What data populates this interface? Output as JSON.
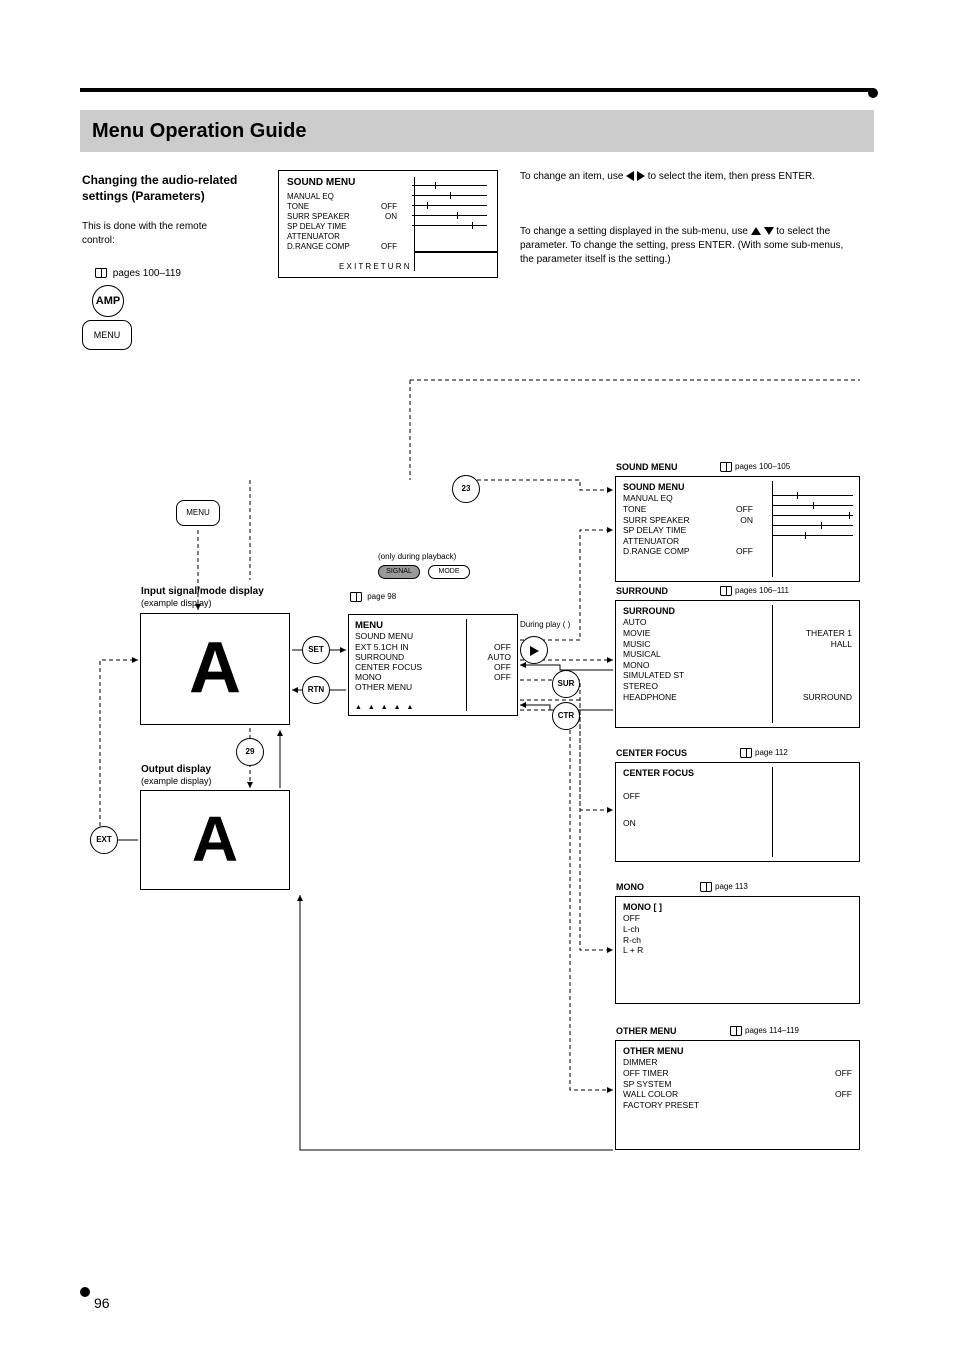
{
  "header": {
    "section_title": "Menu Operation Guide"
  },
  "intro": {
    "heading": "Changing the audio-related settings (Parameters)",
    "note": "This is done with the remote control:",
    "book_ref": "pages 100–119",
    "btn_amp": "AMP",
    "btn_menu": "MENU"
  },
  "top_panel": {
    "title": "SOUND MENU",
    "items": [
      "MANUAL EQ",
      "TONE",
      "SURR SPEAKER",
      "SP DELAY TIME",
      "ATTENUATOR",
      "D.RANGE COMP"
    ],
    "values": [
      "",
      "OFF",
      "ON",
      "",
      "",
      "OFF"
    ],
    "icons_caption": "E X I T  R E T U R N"
  },
  "instr1": {
    "text_a": "To change an item, use",
    "text_b": "to select the item, then press ENTER."
  },
  "instr2": {
    "text_a": "To change a setting displayed in the sub-menu, use",
    "text_b": "to select the parameter. To change the setting, press ENTER. (With some sub-menus, the parameter itself is the setting.)"
  },
  "flow": {
    "input_label": "Input signal/mode display",
    "input_note": "(example display)",
    "output_label": "Output display",
    "output_note": "(example display)",
    "menu_rrect": "MENU",
    "menu_circle": "23",
    "to_menu_btn": "SET",
    "from_menu_btn": "RTN",
    "io_toggle": "29",
    "exit_circle": "EXT",
    "cap_signal": "SIGNAL",
    "cap_mode": "MODE",
    "cap_note": "(only during playback)",
    "menu_book_ref": "page 98",
    "edge_play": "During play (  )",
    "round_btn_up": "SUR",
    "round_btn_down": "CTR"
  },
  "menu_panel": {
    "title": "MENU",
    "rows": [
      {
        "l": "SOUND MENU",
        "r": ""
      },
      {
        "l": "EXT 5.1CH IN",
        "r": "OFF"
      },
      {
        "l": "SURROUND",
        "r": "AUTO"
      },
      {
        "l": "CENTER FOCUS",
        "r": "OFF"
      },
      {
        "l": "MONO",
        "r": "OFF"
      },
      {
        "l": "OTHER MENU",
        "r": ""
      }
    ],
    "bars": [
      "▲",
      "▲",
      "▲",
      "▲",
      "▲"
    ]
  },
  "right_panels": {
    "p1": {
      "label": "SOUND MENU",
      "book": "pages 100–105",
      "title": "SOUND MENU",
      "rows": [
        {
          "l": "MANUAL EQ",
          "r": ""
        },
        {
          "l": "TONE",
          "r": "OFF"
        },
        {
          "l": "SURR SPEAKER",
          "r": "ON"
        },
        {
          "l": "SP DELAY TIME",
          "r": ""
        },
        {
          "l": "ATTENUATOR",
          "r": ""
        },
        {
          "l": "D.RANGE COMP",
          "r": "OFF"
        }
      ]
    },
    "p2": {
      "label": "SURROUND",
      "book": "pages 106–111",
      "title": "SURROUND",
      "rows": [
        {
          "l": "AUTO",
          "r": ""
        },
        {
          "l": "MOVIE",
          "r": "THEATER 1"
        },
        {
          "l": "MUSIC",
          "r": "HALL"
        },
        {
          "l": "MUSICAL",
          "r": ""
        },
        {
          "l": "MONO",
          "r": ""
        },
        {
          "l": "SIMULATED ST",
          "r": ""
        },
        {
          "l": "STEREO",
          "r": ""
        },
        {
          "l": "HEADPHONE",
          "r": "SURROUND"
        }
      ]
    },
    "p3": {
      "label": "CENTER FOCUS",
      "book": "page 112",
      "title": "CENTER FOCUS",
      "rows": [
        {
          "l": "OFF",
          "r": ""
        },
        {
          "l": "ON",
          "r": ""
        }
      ]
    },
    "p4": {
      "label": "MONO",
      "book": "page 113",
      "title": "MONO      [          ]",
      "rows": [
        {
          "l": "OFF",
          "r": ""
        },
        {
          "l": "L-ch",
          "r": ""
        },
        {
          "l": "R-ch",
          "r": ""
        },
        {
          "l": "L  +  R",
          "r": ""
        }
      ]
    },
    "p5": {
      "label": "OTHER MENU",
      "book": "pages 114–119",
      "title": "OTHER MENU",
      "rows": [
        {
          "l": "DIMMER",
          "r": ""
        },
        {
          "l": "OFF TIMER",
          "r": "OFF"
        },
        {
          "l": "SP SYSTEM",
          "r": ""
        },
        {
          "l": "WALL COLOR",
          "r": "OFF"
        },
        {
          "l": "FACTORY PRESET",
          "r": ""
        }
      ]
    }
  },
  "page_number": "96"
}
